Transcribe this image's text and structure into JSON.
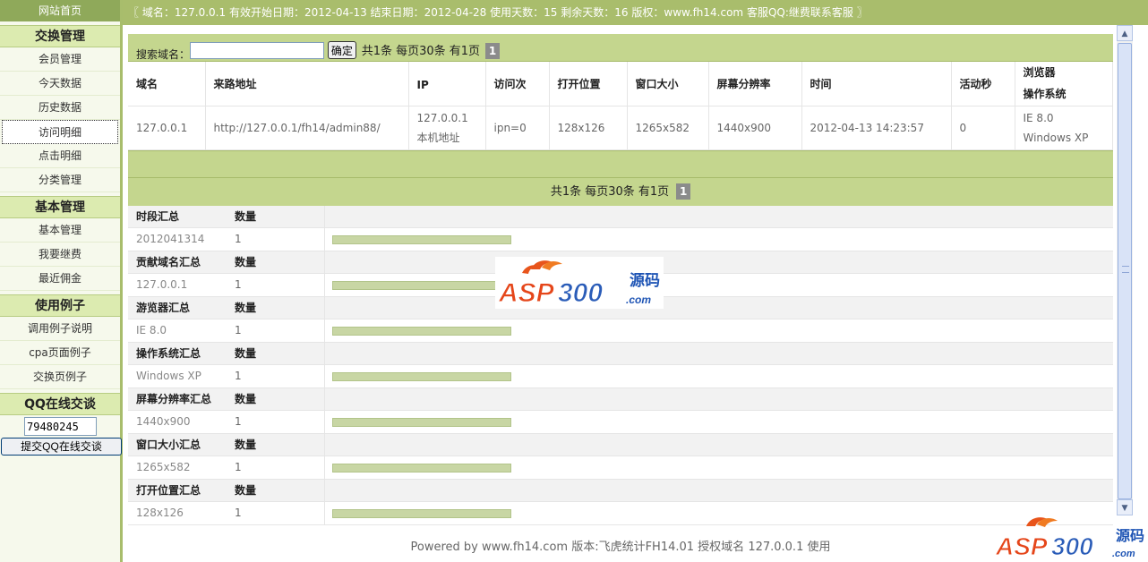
{
  "sidebar": {
    "home": "网站首页",
    "sections": [
      {
        "title": "交换管理",
        "items": [
          "会员管理",
          "今天数据",
          "历史数据",
          "访问明细",
          "点击明细",
          "分类管理"
        ]
      },
      {
        "title": "基本管理",
        "items": [
          "基本管理",
          "我要继费",
          "最近佣金"
        ]
      },
      {
        "title": "使用例子",
        "items": [
          "调用例子说明",
          "cpa页面例子",
          "交换页例子"
        ]
      }
    ],
    "active_item": "访问明细",
    "qq": {
      "title": "QQ在线交谈",
      "value": "79480245",
      "button": "提交QQ在线交谈"
    }
  },
  "topbar": {
    "open_bracket": "〖",
    "domain_label": "域名：",
    "domain": "127.0.0.1",
    "start_label": "有效开始日期：",
    "start_date": "2012-04-13",
    "end_label": "结束日期：",
    "end_date": "2012-04-28",
    "used_label": "使用天数：",
    "used_days": "15",
    "remain_label": "剩余天数：",
    "remain_days": "16",
    "copyright_label": "版权：",
    "site": "www.fh14.com",
    "qq_label": "客服QQ:",
    "qq_text": "继费联系客服",
    "close_bracket": "〗"
  },
  "search": {
    "label": "搜索域名：",
    "value": "",
    "button": "确定",
    "summary": "共1条  每页30条  有1页",
    "page": "1"
  },
  "detail_table": {
    "headers": [
      "域名",
      "来路地址",
      "IP",
      "访问次",
      "打开位置",
      "窗口大小",
      "屏幕分辨率",
      "时间",
      "活动秒",
      "浏览器",
      "操作系统"
    ],
    "row": {
      "domain": "127.0.0.1",
      "referrer": "http://127.0.0.1/fh14/admin88/",
      "ip": "127.0.0.1",
      "ip_note": "本机地址",
      "visits": "ipn=0",
      "open_pos": "128x126",
      "window": "1265x582",
      "screen": "1440x900",
      "time": "2012-04-13 14:23:57",
      "active": "0",
      "browser": "IE 8.0",
      "os": "Windows XP"
    }
  },
  "pager": {
    "summary": "共1条  每页30条  有1页",
    "page": "1"
  },
  "summaries": [
    {
      "title": "时段汇总",
      "count_label": "数量",
      "name": "2012041314",
      "count": "1",
      "bar_fraction": 0.27
    },
    {
      "title": "贡献域名汇总",
      "count_label": "数量",
      "name": "127.0.0.1",
      "count": "1",
      "bar_fraction": 0.27
    },
    {
      "title": "游览器汇总",
      "count_label": "数量",
      "name": "IE 8.0",
      "count": "1",
      "bar_fraction": 0.27
    },
    {
      "title": "操作系统汇总",
      "count_label": "数量",
      "name": "Windows XP",
      "count": "1",
      "bar_fraction": 0.27
    },
    {
      "title": "屏幕分辨率汇总",
      "count_label": "数量",
      "name": "1440x900",
      "count": "1",
      "bar_fraction": 0.27
    },
    {
      "title": "窗口大小汇总",
      "count_label": "数量",
      "name": "1265x582",
      "count": "1",
      "bar_fraction": 0.27
    },
    {
      "title": "打开位置汇总",
      "count_label": "数量",
      "name": "128x126",
      "count": "1",
      "bar_fraction": 0.27
    }
  ],
  "footer": "Powered by www.fh14.com 版本:飞虎统计FH14.01 授权域名  127.0.0.1 使用",
  "watermark": {
    "brand": "ASP300",
    "suffix": "源码",
    "domain": ".com"
  },
  "colors": {
    "olive": "#a9bd6c",
    "light_olive": "#c4d68e",
    "sidebar_bg": "#f6f9ec",
    "bar": "#c8d6a4"
  }
}
